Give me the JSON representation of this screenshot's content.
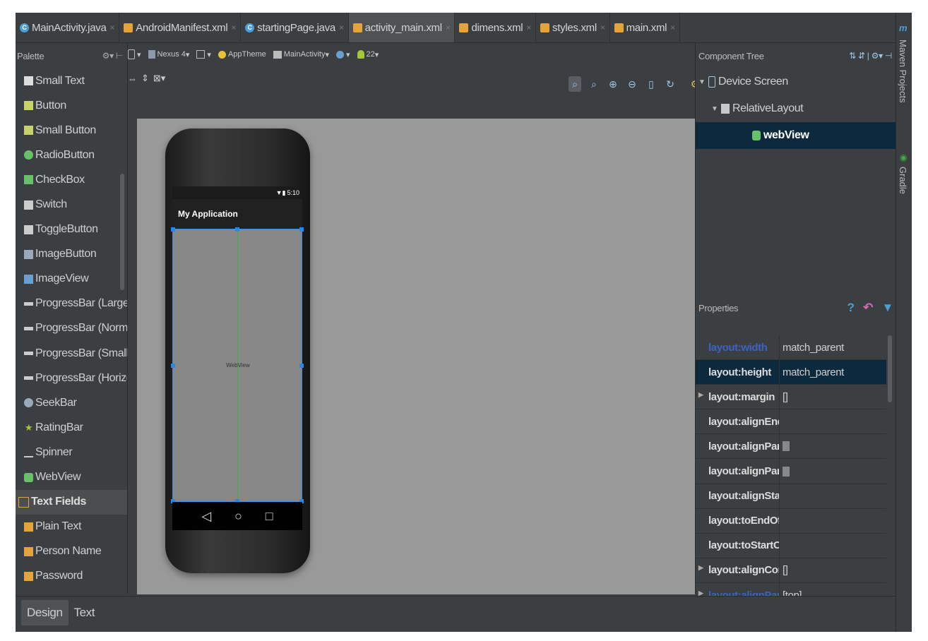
{
  "tabs": [
    {
      "label": "MainActivity.java",
      "type": "java",
      "active": false
    },
    {
      "label": "AndroidManifest.xml",
      "type": "xml",
      "active": false
    },
    {
      "label": "startingPage.java",
      "type": "java",
      "active": false
    },
    {
      "label": "activity_main.xml",
      "type": "xml",
      "active": true
    },
    {
      "label": "dimens.xml",
      "type": "xml",
      "active": false
    },
    {
      "label": "styles.xml",
      "type": "xml",
      "active": false
    },
    {
      "label": "main.xml",
      "type": "xml",
      "active": false
    }
  ],
  "palette": {
    "title": "Palette",
    "items": [
      {
        "label": "Small Text",
        "icon": "text-icon",
        "group": false
      },
      {
        "label": "Button",
        "icon": "button-icon",
        "group": false
      },
      {
        "label": "Small Button",
        "icon": "button-icon",
        "group": false
      },
      {
        "label": "RadioButton",
        "icon": "radio-icon",
        "group": false
      },
      {
        "label": "CheckBox",
        "icon": "checkbox-icon",
        "group": false
      },
      {
        "label": "Switch",
        "icon": "switch-icon",
        "group": false
      },
      {
        "label": "ToggleButton",
        "icon": "toggle-icon",
        "group": false
      },
      {
        "label": "ImageButton",
        "icon": "image-button-icon",
        "group": false
      },
      {
        "label": "ImageView",
        "icon": "image-icon",
        "group": false
      },
      {
        "label": "ProgressBar (Large)",
        "icon": "progress-icon",
        "group": false
      },
      {
        "label": "ProgressBar (Norma",
        "icon": "progress-icon",
        "group": false
      },
      {
        "label": "ProgressBar (Small)",
        "icon": "progress-icon",
        "group": false
      },
      {
        "label": "ProgressBar (Horizo",
        "icon": "progress-icon",
        "group": false
      },
      {
        "label": "SeekBar",
        "icon": "seekbar-icon",
        "group": false
      },
      {
        "label": "RatingBar",
        "icon": "star-icon",
        "group": false
      },
      {
        "label": "Spinner",
        "icon": "spinner-icon",
        "group": false
      },
      {
        "label": "WebView",
        "icon": "webview-icon",
        "group": false
      },
      {
        "label": "Text Fields",
        "icon": "folder-icon",
        "group": true
      },
      {
        "label": "Plain Text",
        "icon": "textfield-icon",
        "group": false
      },
      {
        "label": "Person Name",
        "icon": "textfield-icon",
        "group": false
      },
      {
        "label": "Password",
        "icon": "textfield-icon",
        "group": false
      }
    ]
  },
  "toolbar": {
    "device": "Nexus 4",
    "theme": "AppTheme",
    "activity": "MainActivity",
    "api": "22"
  },
  "phone": {
    "time": "5:10",
    "app_title": "My Application",
    "webview_label": "WebView"
  },
  "component_tree": {
    "title": "Component Tree",
    "nodes": [
      {
        "label": "Device Screen",
        "level": 0,
        "selected": false
      },
      {
        "label": "RelativeLayout",
        "level": 1,
        "selected": false
      },
      {
        "label": "webView",
        "level": 2,
        "selected": true
      }
    ]
  },
  "properties": {
    "title": "Properties",
    "rows": [
      {
        "name": "layout:width",
        "value": "match_parent",
        "modified": true,
        "expandable": false,
        "selected": false,
        "checkbox": false
      },
      {
        "name": "layout:height",
        "value": "match_parent",
        "modified": false,
        "expandable": false,
        "selected": true,
        "checkbox": false
      },
      {
        "name": "layout:margin",
        "value": "[]",
        "modified": false,
        "expandable": true,
        "selected": false,
        "checkbox": false
      },
      {
        "name": "layout:alignEnd",
        "value": "",
        "modified": false,
        "expandable": false,
        "selected": false,
        "checkbox": false
      },
      {
        "name": "layout:alignParentl",
        "value": "",
        "modified": false,
        "expandable": false,
        "selected": false,
        "checkbox": true
      },
      {
        "name": "layout:alignParent!",
        "value": "",
        "modified": false,
        "expandable": false,
        "selected": false,
        "checkbox": true
      },
      {
        "name": "layout:alignStart",
        "value": "",
        "modified": false,
        "expandable": false,
        "selected": false,
        "checkbox": false
      },
      {
        "name": "layout:toEndOf",
        "value": "",
        "modified": false,
        "expandable": false,
        "selected": false,
        "checkbox": false
      },
      {
        "name": "layout:toStartOf",
        "value": "",
        "modified": false,
        "expandable": false,
        "selected": false,
        "checkbox": false
      },
      {
        "name": "layout:alignCompo",
        "value": "[]",
        "modified": false,
        "expandable": true,
        "selected": false,
        "checkbox": false
      },
      {
        "name": "layout:alignParent",
        "value": "[top]",
        "modified": true,
        "expandable": true,
        "selected": false,
        "checkbox": false
      }
    ]
  },
  "bottom_tabs": [
    {
      "label": "Design",
      "active": true
    },
    {
      "label": "Text",
      "active": false
    }
  ],
  "right_bar": {
    "maven": "Maven Projects",
    "gradle": "Gradle"
  },
  "colors": {
    "background": "#3c3f41",
    "selection": "#0d293e",
    "canvas": "#999999",
    "webview_border": "#3d8ee8",
    "guide_line": "#3cb043"
  }
}
